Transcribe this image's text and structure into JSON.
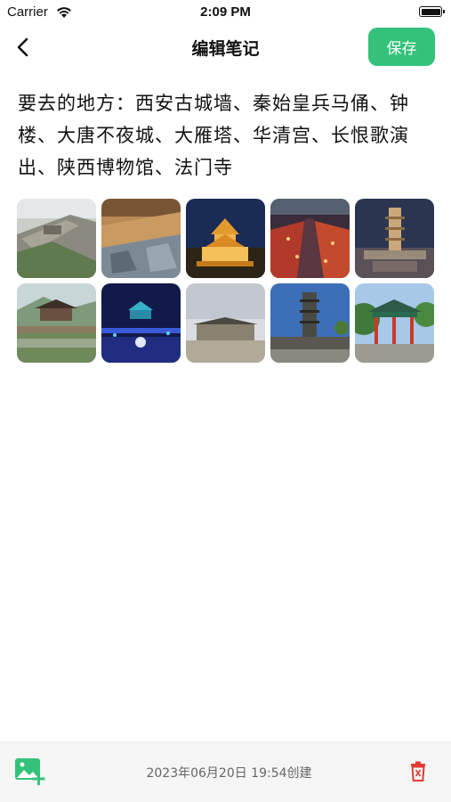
{
  "status_bar": {
    "carrier": "Carrier",
    "time": "2:09 PM",
    "battery_level": 0.9
  },
  "nav": {
    "back_icon": "chevron-left-icon",
    "title": "编辑笔记",
    "save_label": "保存"
  },
  "note": {
    "content": "要去的地方：西安古城墙、秦始皇兵马俑、钟楼、大唐不夜城、大雁塔、华清宫、长恨歌演出、陕西博物馆、法门寺"
  },
  "photos_count": 10,
  "footer": {
    "add_photo_icon": "add-photo-icon",
    "created_text": "2023年06月20日 19:54创建",
    "delete_icon": "trash-icon"
  },
  "colors": {
    "accent": "#34c27a",
    "delete": "#e53935",
    "footer_bg": "#f5f5f5"
  }
}
